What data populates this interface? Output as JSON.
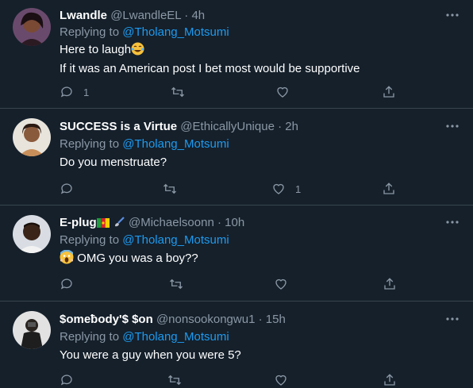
{
  "tweets": [
    {
      "name": "Lwandle",
      "handle": "@LwandleEL",
      "dot": "·",
      "time": "4h",
      "replying_prefix": "Replying to ",
      "replying_to": "@Tholang_Motsumi",
      "lines": [
        "Here to laugh",
        "If it was an American post I bet most would be supportive"
      ],
      "reply_count": "1",
      "retweet_count": "",
      "like_count": ""
    },
    {
      "name": "SUCCESS is a Virtue",
      "handle": "@EthicallyUnique",
      "dot": "·",
      "time": "2h",
      "replying_prefix": "Replying to ",
      "replying_to": "@Tholang_Motsumi",
      "lines": [
        "Do you menstruate?"
      ],
      "reply_count": "",
      "retweet_count": "",
      "like_count": "1"
    },
    {
      "name": "E-plug",
      "handle": "@Michaelsoonn",
      "dot": "·",
      "time": "10h",
      "replying_prefix": "Replying to ",
      "replying_to": "@Tholang_Motsumi",
      "lines": [
        "OMG you was a boy??"
      ],
      "reply_count": "",
      "retweet_count": "",
      "like_count": ""
    },
    {
      "name": "$omeƀody'$ $on",
      "handle": "@nonsookongwu1",
      "dot": "·",
      "time": "15h",
      "replying_prefix": "Replying to ",
      "replying_to": "@Tholang_Motsumi",
      "lines": [
        "You were a guy when you were 5?"
      ],
      "reply_count": "",
      "retweet_count": "",
      "like_count": ""
    }
  ],
  "colors": {
    "background": "#15202b",
    "muted": "#8b98a5",
    "link": "#1d9bf0",
    "divider": "#38444d"
  },
  "icons": [
    "reply-icon",
    "retweet-icon",
    "like-icon",
    "share-icon",
    "more-icon"
  ]
}
